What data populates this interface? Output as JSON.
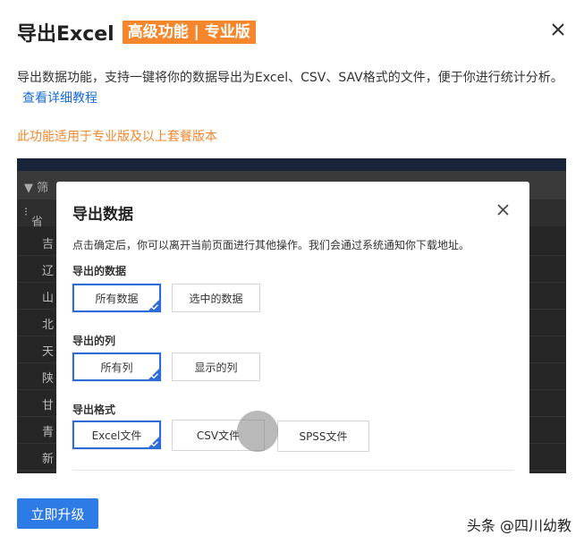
{
  "header": {
    "title": "导出Excel",
    "badge": "高级功能 | 专业版"
  },
  "description": {
    "text": "导出数据功能，支持一键将你的数据导出为Excel、CSV、SAV格式的文件，便于你进行统计分析。",
    "link": "查看详细教程"
  },
  "notice": "此功能适用于专业版及以上套餐版本",
  "background_table": {
    "toolbar_label": "筛",
    "header_label": "省",
    "rows": [
      "吉",
      "辽",
      "山",
      "北",
      "天",
      "陕",
      "甘",
      "青",
      "新"
    ]
  },
  "modal": {
    "title": "导出数据",
    "hint": "点击确定后，你可以离开当前页面进行其他操作。我们会通过系统通知你下载地址。",
    "sections": {
      "data": {
        "label": "导出的数据",
        "options": [
          "所有数据",
          "选中的数据"
        ],
        "selected": "所有数据"
      },
      "columns": {
        "label": "导出的列",
        "options": [
          "所有列",
          "显示的列"
        ],
        "selected": "所有列"
      },
      "format": {
        "label": "导出格式",
        "options": [
          "Excel文件",
          "CSV文件",
          "SPSS文件"
        ],
        "selected": "Excel文件"
      }
    }
  },
  "footer": {
    "upgrade_button": "立即升级",
    "watermark": "头条 @四川幼教"
  },
  "colors": {
    "accent_orange": "#f5862b",
    "primary_blue": "#2f7be6",
    "selection_blue": "#2d6bd6",
    "link_blue": "#1a6cd6"
  },
  "icons": [
    "close-icon",
    "filter-icon",
    "checkmark-icon"
  ]
}
